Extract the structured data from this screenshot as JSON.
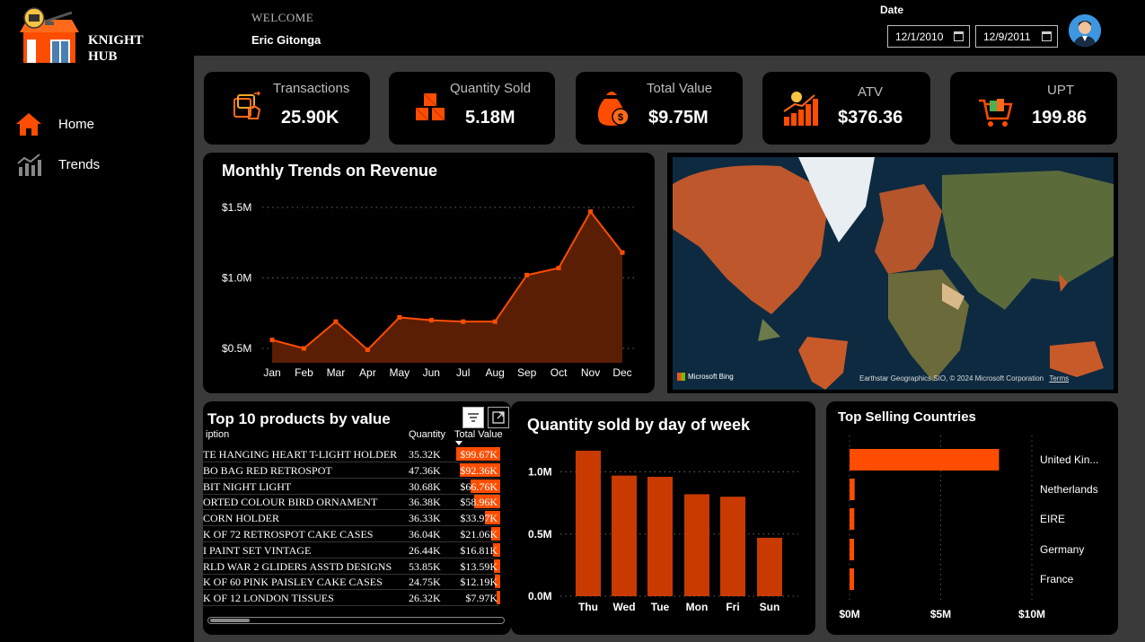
{
  "brand": {
    "line1": "KNIGHT",
    "line2": "HUB"
  },
  "nav": [
    {
      "label": "Home",
      "icon": "home-icon"
    },
    {
      "label": "Trends",
      "icon": "trends-icon"
    }
  ],
  "header": {
    "welcome": "WELCOME",
    "user": "Eric Gitonga",
    "date_label": "Date",
    "date_start": "12/1/2010",
    "date_end": "12/9/2011"
  },
  "kpis": [
    {
      "title": "Transactions",
      "value": "25.90K",
      "icon": "transactions-icon"
    },
    {
      "title": "Quantity Sold",
      "value": "5.18M",
      "icon": "boxes-icon"
    },
    {
      "title": "Total Value",
      "value": "$9.75M",
      "icon": "money-bag-icon"
    },
    {
      "title": "ATV",
      "value": "$376.36",
      "icon": "growth-chart-icon"
    },
    {
      "title": "UPT",
      "value": "199.86",
      "icon": "shopping-cart-icon"
    }
  ],
  "colors": {
    "accent": "#ff4d00",
    "area_fill": "#5a1e05",
    "bar_dark": "#c83a00"
  },
  "revenue_chart": {
    "title": "Monthly Trends on Revenue"
  },
  "map": {
    "bing": "Microsoft Bing",
    "credit": "Earthstar Geographics SIO, © 2024 Microsoft Corporation",
    "terms": "Terms"
  },
  "products": {
    "title": "Top 10 products by value",
    "col_desc": "iption",
    "col_qty": "Quantity",
    "col_val": "Total Value",
    "rows": [
      {
        "d": "TE HANGING HEART T-LIGHT HOLDER",
        "q": "35.32K",
        "v": "$99.67K",
        "n": 99.67
      },
      {
        "d": "BO BAG RED RETROSPOT",
        "q": "47.36K",
        "v": "$92.36K",
        "n": 92.36
      },
      {
        "d": "BIT NIGHT LIGHT",
        "q": "30.68K",
        "v": "$66.76K",
        "n": 66.76
      },
      {
        "d": "ORTED COLOUR BIRD ORNAMENT",
        "q": "36.38K",
        "v": "$58.96K",
        "n": 58.96
      },
      {
        "d": "CORN HOLDER",
        "q": "36.33K",
        "v": "$33.97K",
        "n": 33.97
      },
      {
        "d": "K OF 72 RETROSPOT CAKE CASES",
        "q": "36.04K",
        "v": "$21.06K",
        "n": 21.06
      },
      {
        "d": "I PAINT SET VINTAGE",
        "q": "26.44K",
        "v": "$16.81K",
        "n": 16.81
      },
      {
        "d": "RLD WAR 2 GLIDERS ASSTD DESIGNS",
        "q": "53.85K",
        "v": "$13.59K",
        "n": 13.59
      },
      {
        "d": "K OF 60 PINK PAISLEY CAKE CASES",
        "q": "24.75K",
        "v": "$12.19K",
        "n": 12.19
      },
      {
        "d": "K OF 12 LONDON TISSUES",
        "q": "26.32K",
        "v": "$7.97K",
        "n": 7.97
      }
    ]
  },
  "dow_chart": {
    "title": "Quantity sold by day of week"
  },
  "countries_chart": {
    "title": "Top Selling Countries"
  },
  "chart_data": [
    {
      "type": "area",
      "title": "Monthly Trends on Revenue",
      "categories": [
        "Jan",
        "Feb",
        "Mar",
        "Apr",
        "May",
        "Jun",
        "Jul",
        "Aug",
        "Sep",
        "Oct",
        "Nov",
        "Dec"
      ],
      "values": [
        0.56,
        0.5,
        0.69,
        0.49,
        0.72,
        0.7,
        0.69,
        0.69,
        1.02,
        1.07,
        1.47,
        1.18
      ],
      "ylim": [
        0.4,
        1.6
      ],
      "yticks": [
        {
          "v": 0.5,
          "label": "$0.5M"
        },
        {
          "v": 1.0,
          "label": "$1.0M"
        },
        {
          "v": 1.5,
          "label": "$1.5M"
        }
      ],
      "grid": true
    },
    {
      "type": "bar",
      "title": "Quantity sold by day of week",
      "categories": [
        "Thu",
        "Wed",
        "Tue",
        "Mon",
        "Fri",
        "Sun"
      ],
      "values": [
        1.17,
        0.97,
        0.96,
        0.82,
        0.8,
        0.47
      ],
      "ylim": [
        0,
        1.3
      ],
      "yticks": [
        {
          "v": 0,
          "label": "0.0M"
        },
        {
          "v": 0.5,
          "label": "0.5M"
        },
        {
          "v": 1.0,
          "label": "1.0M"
        }
      ],
      "grid": true
    },
    {
      "type": "bar",
      "orientation": "horizontal",
      "title": "Top Selling Countries",
      "categories": [
        "United Kin...",
        "Netherlands",
        "EIRE",
        "Germany",
        "France"
      ],
      "values": [
        8.2,
        0.28,
        0.26,
        0.22,
        0.2
      ],
      "xlim": [
        0,
        10
      ],
      "xticks": [
        {
          "v": 0,
          "label": "$0M"
        },
        {
          "v": 5,
          "label": "$5M"
        },
        {
          "v": 10,
          "label": "$10M"
        }
      ],
      "grid": true
    }
  ]
}
